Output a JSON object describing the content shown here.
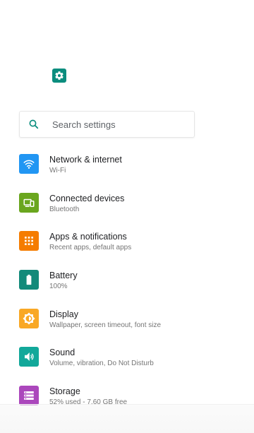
{
  "search": {
    "placeholder": "Search settings",
    "value": ""
  },
  "colors": {
    "app_icon": "#0b8d7e",
    "search_icon": "#0b8d7e",
    "network": "#2196f3",
    "connected": "#6aa61e",
    "apps": "#f57c00",
    "battery": "#138a7a",
    "display": "#f9a825",
    "sound": "#12a89a",
    "storage": "#ab47bc"
  },
  "items": [
    {
      "title": "Network & internet",
      "subtitle": "Wi-Fi",
      "icon": "wifi-icon"
    },
    {
      "title": "Connected devices",
      "subtitle": "Bluetooth",
      "icon": "devices-icon"
    },
    {
      "title": "Apps & notifications",
      "subtitle": "Recent apps, default apps",
      "icon": "apps-grid-icon"
    },
    {
      "title": "Battery",
      "subtitle": "100%",
      "icon": "battery-icon"
    },
    {
      "title": "Display",
      "subtitle": "Wallpaper, screen timeout, font size",
      "icon": "brightness-icon"
    },
    {
      "title": "Sound",
      "subtitle": "Volume, vibration, Do Not Disturb",
      "icon": "volume-icon"
    },
    {
      "title": "Storage",
      "subtitle": "52% used - 7.60 GB free",
      "icon": "storage-icon"
    }
  ]
}
